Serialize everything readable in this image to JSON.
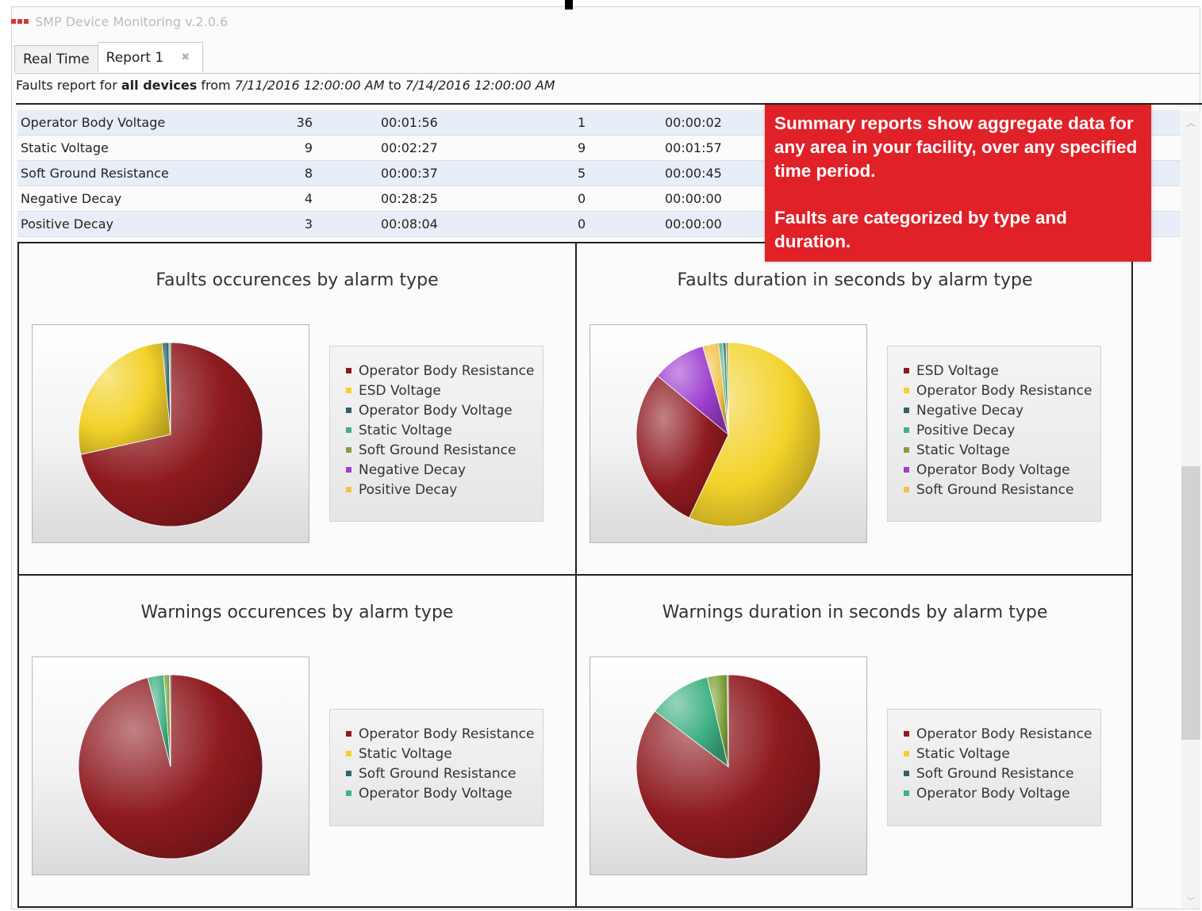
{
  "app": {
    "title": "SMP Device Monitoring v.2.0.6"
  },
  "tabs": [
    {
      "label": "Real Time"
    },
    {
      "label": "Report 1",
      "close_icon": "close-icon"
    }
  ],
  "report_line": {
    "prefix": "Faults report for ",
    "scope": "all devices",
    "from_word": " from ",
    "start": "7/11/2016 12:00:00 AM",
    "to_word": " to ",
    "end": "7/14/2016 12:00:00 AM"
  },
  "table": {
    "rows": [
      [
        "Operator Body Voltage",
        "36",
        "00:01:56",
        "1",
        "00:00:02"
      ],
      [
        "Static Voltage",
        "9",
        "00:02:27",
        "9",
        "00:01:57"
      ],
      [
        "Soft Ground Resistance",
        "8",
        "00:00:37",
        "5",
        "00:00:45"
      ],
      [
        "Negative Decay",
        "4",
        "00:28:25",
        "0",
        "00:00:00"
      ],
      [
        "Positive Decay",
        "3",
        "00:08:04",
        "0",
        "00:00:00"
      ]
    ]
  },
  "callout": {
    "line1": "Summary reports show aggregate data for any area in your facility, over any specified time period.",
    "line2": "Faults are categorized by type and duration."
  },
  "colors": {
    "Operator Body Resistance": "#8e1a1f",
    "ESD Voltage": "#f3d22a",
    "Operator Body Voltage": "#2f6468",
    "Static Voltage": "#40b184",
    "Soft Ground Resistance": "#7fa33a",
    "Negative Decay": "#9d3fcf",
    "Positive Decay": "#f2c14a"
  },
  "chart_data": [
    {
      "type": "pie",
      "title": "Faults occurences by alarm type",
      "legend": [
        "Operator Body Resistance",
        "ESD Voltage",
        "Operator Body Voltage",
        "Static Voltage",
        "Soft Ground Resistance",
        "Negative Decay",
        "Positive Decay"
      ],
      "legend_colors": [
        "#8e1a1f",
        "#f3d22a",
        "#2f6468",
        "#40b184",
        "#7fa33a",
        "#9d3fcf",
        "#f2c14a"
      ],
      "slices": [
        {
          "label": "Operator Body Resistance",
          "value": 71.5
        },
        {
          "label": "ESD Voltage",
          "value": 27.0
        },
        {
          "label": "Operator Body Voltage",
          "value": 1.2
        },
        {
          "label": "Static Voltage",
          "value": 0.3
        }
      ]
    },
    {
      "type": "pie",
      "title": "Faults duration in seconds by alarm type",
      "legend": [
        "ESD Voltage",
        "Operator Body Resistance",
        "Negative Decay",
        "Positive Decay",
        "Static Voltage",
        "Operator Body Voltage",
        "Soft Ground Resistance"
      ],
      "legend_colors": [
        "#8e1a1f",
        "#f3d22a",
        "#2f6468",
        "#40b184",
        "#7fa33a",
        "#9d3fcf",
        "#f2c14a"
      ],
      "slices": [
        {
          "label": "ESD Voltage",
          "value": 57.0
        },
        {
          "label": "Operator Body Resistance",
          "value": 29.0
        },
        {
          "label": "Negative Decay",
          "value": 9.5
        },
        {
          "label": "Positive Decay",
          "value": 2.8
        },
        {
          "label": "Static Voltage",
          "value": 0.7
        },
        {
          "label": "Operator Body Voltage",
          "value": 0.6
        },
        {
          "label": "Soft Ground Resistance",
          "value": 0.4
        }
      ]
    },
    {
      "type": "pie",
      "title": "Warnings occurences by alarm type",
      "legend": [
        "Operator Body Resistance",
        "Static Voltage",
        "Soft Ground Resistance",
        "Operator Body Voltage"
      ],
      "legend_colors": [
        "#8e1a1f",
        "#f3d22a",
        "#2f6468",
        "#40b184"
      ],
      "slices": [
        {
          "label": "Operator Body Resistance",
          "value": 96.0
        },
        {
          "label": "Static Voltage",
          "value": 2.8
        },
        {
          "label": "Soft Ground Resistance",
          "value": 1.0
        },
        {
          "label": "Operator Body Voltage",
          "value": 0.2
        }
      ]
    },
    {
      "type": "pie",
      "title": "Warnings duration in seconds by alarm type",
      "legend": [
        "Operator Body Resistance",
        "Static Voltage",
        "Soft Ground Resistance",
        "Operator Body Voltage"
      ],
      "legend_colors": [
        "#8e1a1f",
        "#f3d22a",
        "#2f6468",
        "#40b184"
      ],
      "slices": [
        {
          "label": "Operator Body Resistance",
          "value": 85.3
        },
        {
          "label": "Static Voltage",
          "value": 11.0
        },
        {
          "label": "Soft Ground Resistance",
          "value": 3.5
        },
        {
          "label": "Operator Body Voltage",
          "value": 0.2
        }
      ]
    }
  ]
}
